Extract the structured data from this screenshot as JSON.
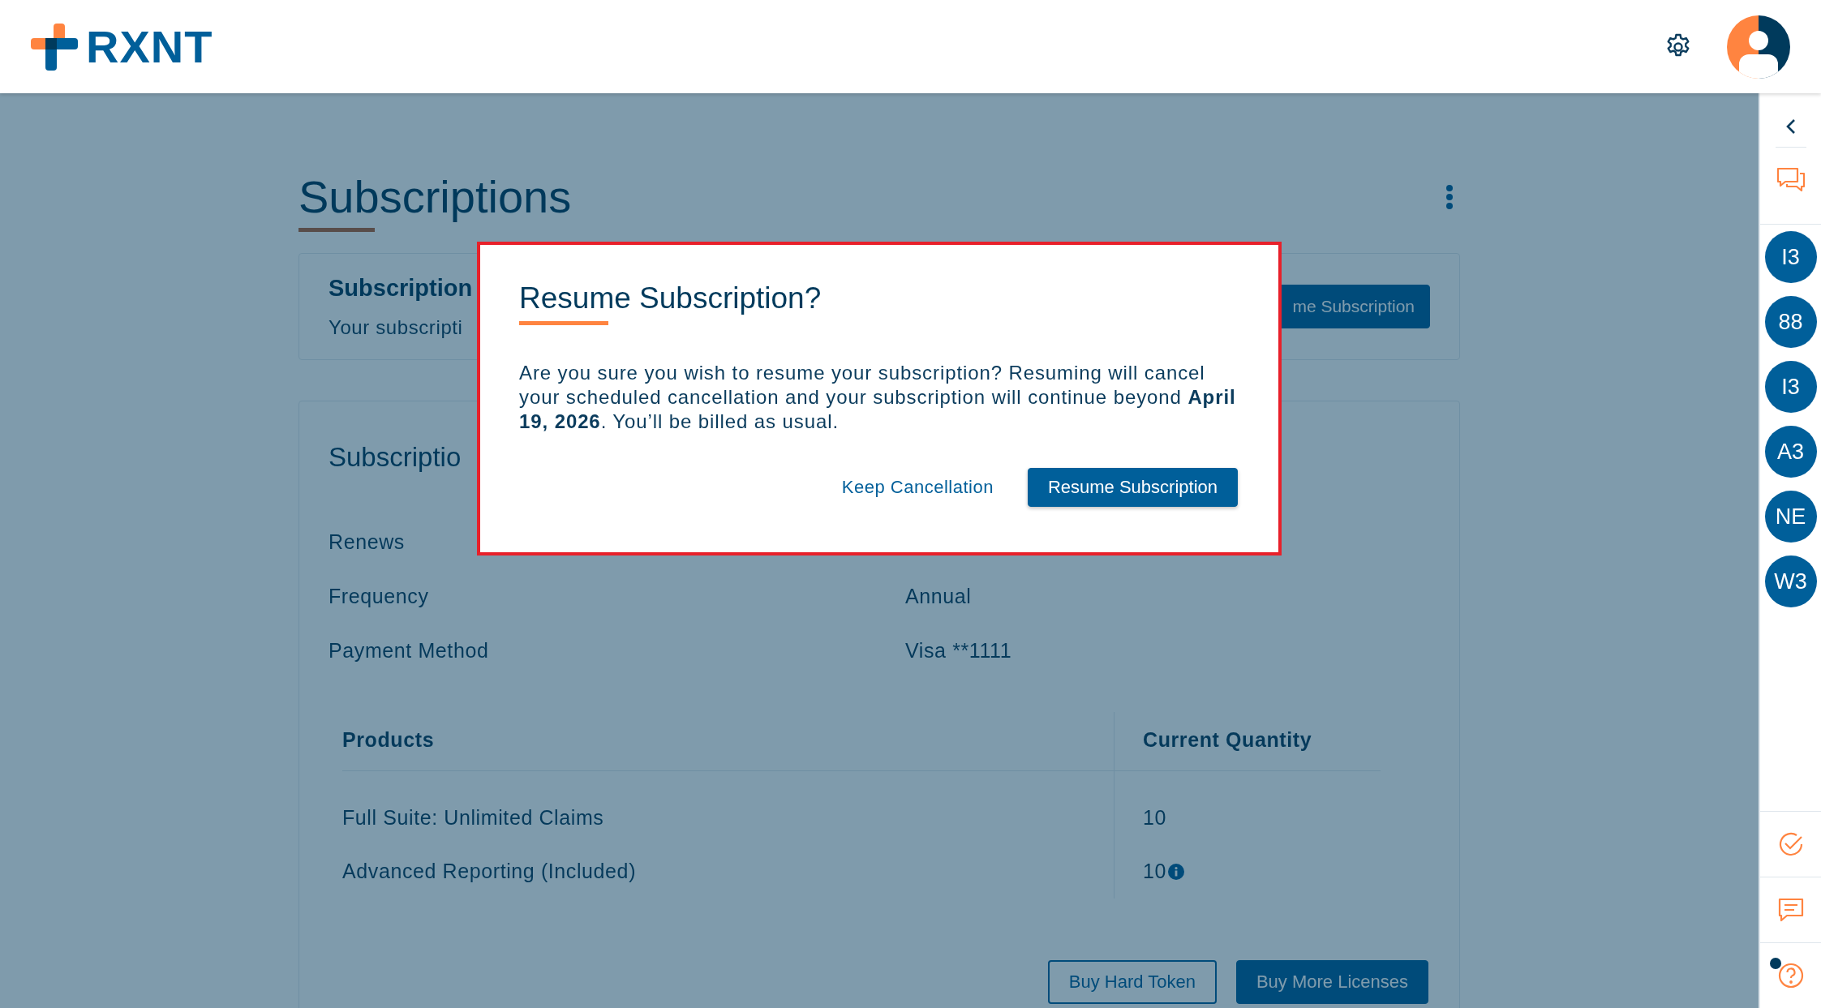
{
  "header": {
    "logo_text": "RXNT"
  },
  "page": {
    "title": "Subscriptions"
  },
  "status_card": {
    "title": "Subscription",
    "text": "Your subscripti",
    "button": "me Subscription"
  },
  "details_card": {
    "title": "Subscriptio",
    "fields": [
      {
        "label": "Renews"
      },
      {
        "label": "Frequency",
        "value": "Annual"
      },
      {
        "label": "Payment Method",
        "value": "Visa **1111"
      }
    ],
    "table": {
      "columns": [
        "Products",
        "Current Quantity"
      ],
      "rows": [
        {
          "product": "Full Suite: Unlimited Claims",
          "quantity": "10",
          "info": false
        },
        {
          "product": "Advanced Reporting (Included)",
          "quantity": "10",
          "info": true
        }
      ]
    },
    "buttons": [
      {
        "label": "Buy Hard Token",
        "kind": "outline"
      },
      {
        "label": "Buy More Licenses",
        "kind": "primary"
      }
    ]
  },
  "dialog": {
    "title": "Resume Subscription?",
    "body": "Are you sure you wish to resume your subscription? Resuming will cancel your scheduled cancellation and your subscription will continue beyond **April 19, 2026**. You’ll be billed as usual.",
    "buttons": [
      {
        "label": "Keep Cancellation",
        "kind": "link"
      },
      {
        "label": "Resume Subscription",
        "kind": "primary"
      }
    ]
  },
  "sidebar": {
    "top": [
      {
        "kind": "chat"
      }
    ],
    "contacts": [
      {
        "label": "I3"
      },
      {
        "label": "88"
      },
      {
        "label": "I3"
      },
      {
        "label": "A3"
      },
      {
        "label": "NE"
      },
      {
        "label": "W3"
      }
    ],
    "bottom": [
      {
        "kind": "check"
      },
      {
        "kind": "message"
      },
      {
        "kind": "help",
        "notification": true
      }
    ]
  }
}
